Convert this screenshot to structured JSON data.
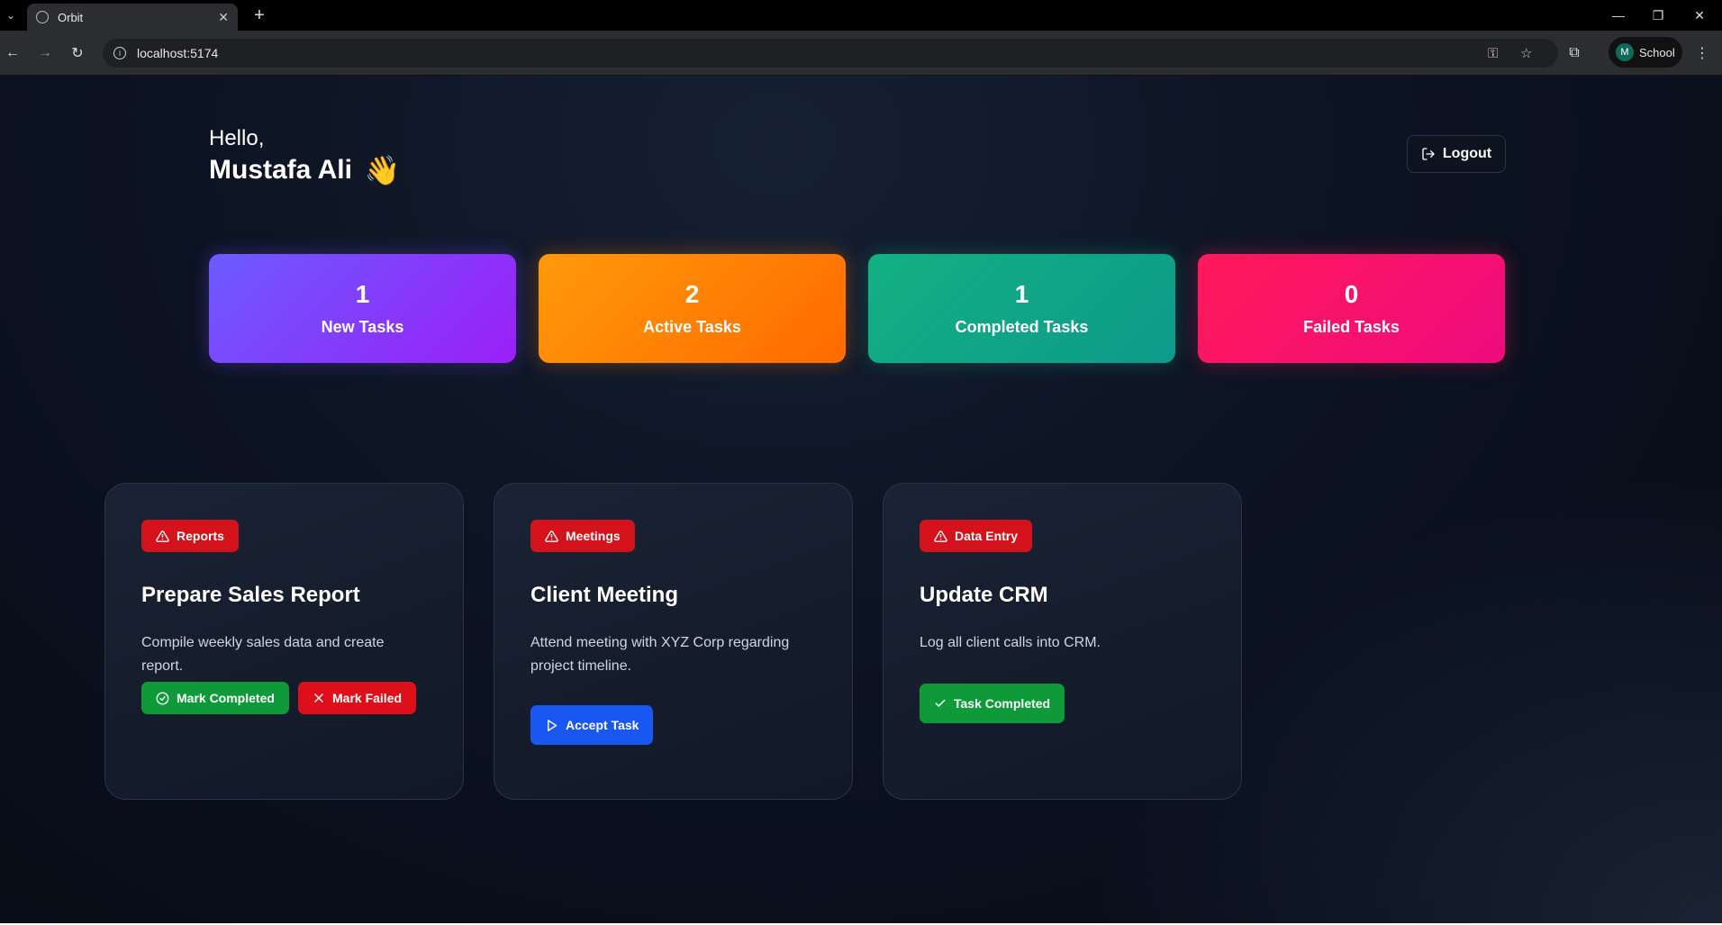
{
  "browser": {
    "tab_title": "Orbit",
    "url": "localhost:5174",
    "profile_initial": "M",
    "profile_name": "School"
  },
  "header": {
    "hello": "Hello,",
    "name": "Mustafa Ali",
    "wave": "👋",
    "logout_label": "Logout"
  },
  "stats": [
    {
      "value": "1",
      "label": "New Tasks",
      "color_from": "#6b5cff",
      "color_to": "#9b1ff7"
    },
    {
      "value": "2",
      "label": "Active Tasks",
      "color_from": "#ff9a0a",
      "color_to": "#ff6a00"
    },
    {
      "value": "1",
      "label": "Completed Tasks",
      "color_from": "#12b083",
      "color_to": "#0e9a8a"
    },
    {
      "value": "0",
      "label": "Failed Tasks",
      "color_from": "#ff1a5a",
      "color_to": "#ef0b7e"
    }
  ],
  "tasks": [
    {
      "category": "Reports",
      "title": "Prepare Sales Report",
      "description": "Compile weekly sales data and create report.",
      "actions": [
        "Mark Completed",
        "Mark Failed"
      ]
    },
    {
      "category": "Meetings",
      "title": "Client Meeting",
      "description": "Attend meeting with XYZ Corp regarding project timeline.",
      "actions": [
        "Accept Task"
      ]
    },
    {
      "category": "Data Entry",
      "title": "Update CRM",
      "description": "Log all client calls into CRM.",
      "actions": [
        "Task Completed"
      ]
    }
  ]
}
